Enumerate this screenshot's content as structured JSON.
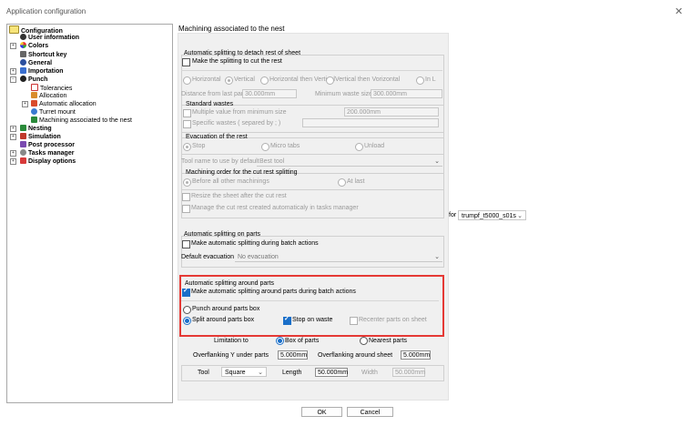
{
  "window": {
    "title": "Application configuration",
    "close_glyph": "✕"
  },
  "tree": {
    "items": [
      {
        "label": "Configuration",
        "bold": true
      },
      {
        "label": "User information",
        "bold": true
      },
      {
        "label": "Colors",
        "bold": true
      },
      {
        "label": "Shortcut key",
        "bold": true
      },
      {
        "label": "General",
        "bold": true
      },
      {
        "label": "Importation",
        "bold": true
      },
      {
        "label": "Punch",
        "bold": true
      },
      {
        "label": "Tolerancies",
        "bold": false
      },
      {
        "label": "Allocation",
        "bold": false
      },
      {
        "label": "Automatic allocation",
        "bold": false
      },
      {
        "label": "Turret mount",
        "bold": false
      },
      {
        "label": "Machining associated to the nest",
        "bold": false
      },
      {
        "label": "Nesting",
        "bold": true
      },
      {
        "label": "Simulation",
        "bold": true
      },
      {
        "label": "Post processor",
        "bold": true
      },
      {
        "label": "Tasks manager",
        "bold": true
      },
      {
        "label": "Display options",
        "bold": true
      }
    ],
    "expanders": {
      "plus": "+",
      "minus": "−"
    }
  },
  "panel": {
    "title": "Machining associated to the nest",
    "machine_label": "for",
    "machine_value": "trumpf_t5000_s01s"
  },
  "split_rest": {
    "title": "Automatic splitting to detach rest of sheet",
    "make_splitting": "Make the splitting to cut the rest",
    "directions": [
      "Horizontal",
      "Vertical",
      "Horizontal then Vertical",
      "Vertical then Vorizontal",
      "In L"
    ],
    "distance_label": "Distance from last part",
    "distance_value": "30.000mm",
    "min_waste_label": "Minimum waste size",
    "min_waste_value": "300.000mm",
    "std_wastes_title": "Standard wastes",
    "multiple_label": "Multiple value from minimum size",
    "multiple_value": "200.000mm",
    "specific_label": "Specific wastes ( separed by ; )",
    "specific_value": "",
    "evac_title": "Evacuation of the rest",
    "evac_options": [
      "Stop",
      "Micro tabs",
      "Unload"
    ],
    "tool_label": "Tool name to use by default",
    "tool_value": "Best tool",
    "order_title": "Machining order for the cut rest splitting",
    "order_options": [
      "Before all other machinings",
      "At last"
    ],
    "resize_label": "Resize the sheet after the cut rest",
    "manage_label": "Manage the cut rest created automaticaly in tasks manager"
  },
  "split_parts": {
    "title": "Automatic splitting on parts",
    "batch_label": "Make automatic splitting during batch actions",
    "evac_label": "Default evacuation",
    "evac_value": "No evacuation"
  },
  "split_around": {
    "title": "Automatic splitting around parts",
    "batch_label": "Make automatic splitting around parts during batch actions",
    "punch_label": "Punch around parts box",
    "split_label": "Split around parts box",
    "stop_label": "Stop on waste",
    "recenter_label": "Recenter parts on sheet",
    "limitation_label": "Limitation to",
    "limitation_options": [
      "Box of parts",
      "Nearest parts"
    ],
    "overflank_y_label": "Overflanking Y under parts",
    "overflank_y_value": "5.000mm",
    "overflank_sheet_label": "Overflanking around sheet",
    "overflank_sheet_value": "5.000mm",
    "tool_label": "Tool",
    "tool_value": "Square",
    "length_label": "Length",
    "length_value": "50.000mm",
    "width_label": "Width",
    "width_value": "50.000mm"
  },
  "buttons": {
    "ok": "OK",
    "cancel": "Cancel"
  },
  "colors": {
    "accent": "#1a6fc9",
    "highlight_border": "#e53935"
  }
}
